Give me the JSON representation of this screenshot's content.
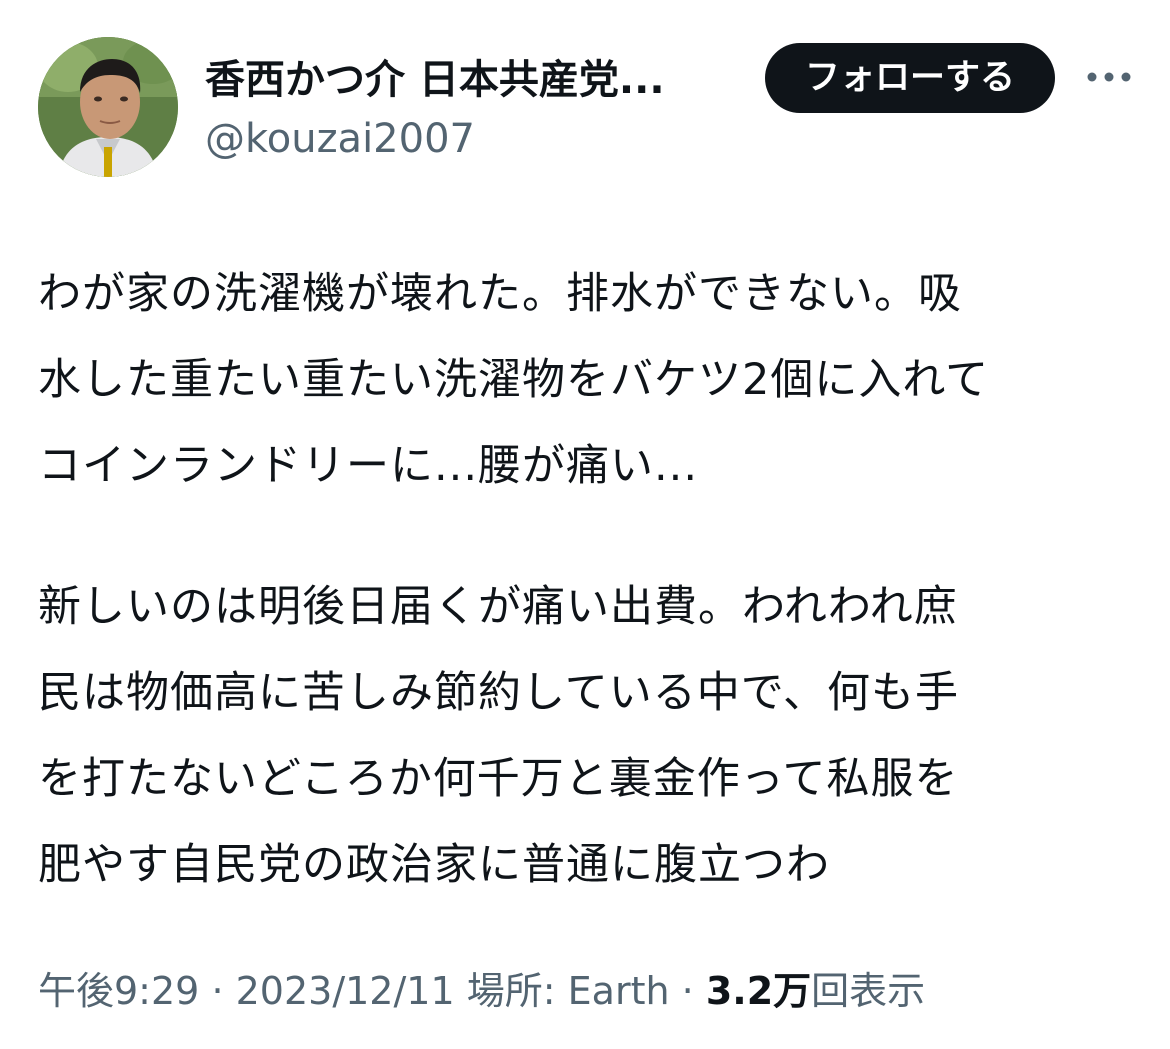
{
  "author": {
    "display_name": "香西かつ介 日本共産党...",
    "handle": "@kouzai2007",
    "avatar_icon": "person-photo-icon"
  },
  "follow_button": {
    "label": "フォローする"
  },
  "more_menu": {
    "icon": "more-horizontal-icon"
  },
  "tweet": {
    "paragraph_1_lines": [
      "わが家の洗濯機が壊れた。排水ができない。吸",
      "水した重たい重たい洗濯物をバケツ2個に入れて",
      "コインランドリーに...腰が痛い..."
    ],
    "paragraph_2_lines": [
      "新しいのは明後日届くが痛い出費。われわれ庶",
      "民は物価高に苦しみ節約している中で、何も手",
      "を打たないどころか何千万と裏金作って私服を",
      "肥やす自民党の政治家に普通に腹立つわ"
    ]
  },
  "meta": {
    "time": "午後9:29",
    "date": "2023/12/11",
    "location_label": "場所:",
    "location": "Earth",
    "views_count": "3.2万",
    "views_label": "回表示",
    "separator": "·"
  },
  "colors": {
    "text_primary": "#0f1419",
    "text_secondary": "#536471",
    "button_bg": "#0f1419",
    "button_text": "#ffffff"
  }
}
